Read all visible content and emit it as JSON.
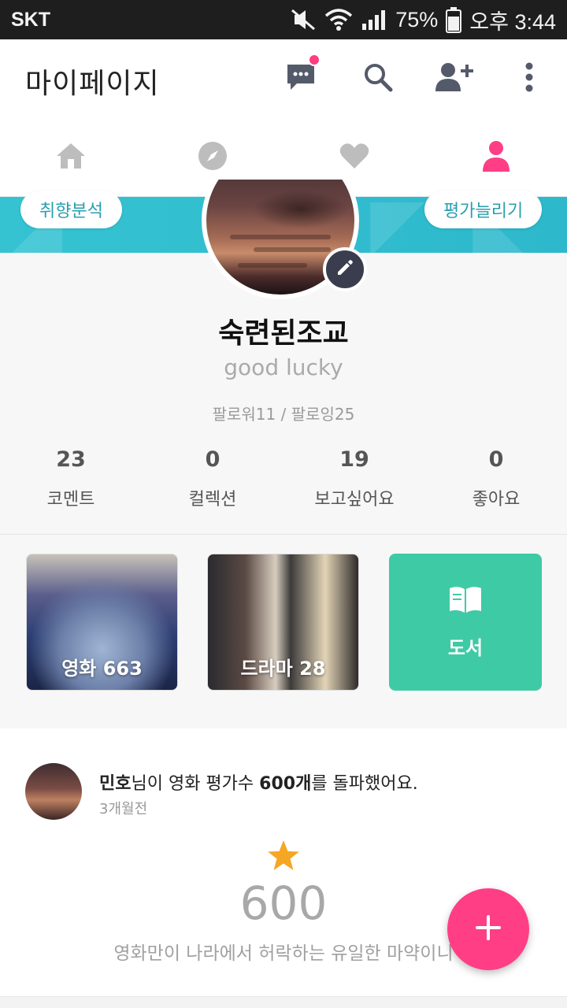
{
  "status_bar": {
    "carrier": "SKT",
    "battery": "75%",
    "time": "오후 3:44"
  },
  "app_bar": {
    "title": "마이페이지",
    "icons": [
      "chat-icon",
      "search-icon",
      "add-friend-icon",
      "more-vert-icon"
    ],
    "notification_dot_color": "#ff3e7f"
  },
  "nav_tabs": {
    "items": [
      {
        "name": "home",
        "icon": "home-icon",
        "active": false
      },
      {
        "name": "explore",
        "icon": "compass-icon",
        "active": false
      },
      {
        "name": "favorites",
        "icon": "heart-icon",
        "active": false
      },
      {
        "name": "profile",
        "icon": "person-icon",
        "active": true
      }
    ],
    "active_color": "#ff3e86",
    "inactive_color": "#bdbdbd"
  },
  "profile": {
    "analysis_button": "취향분석",
    "rate_more_button": "평가늘리기",
    "name": "숙련된조교",
    "bio": "good lucky",
    "follow_text": "팔로워11 / 팔로잉25",
    "stats": [
      {
        "value": "23",
        "label": "코멘트"
      },
      {
        "value": "0",
        "label": "컬렉션"
      },
      {
        "value": "19",
        "label": "보고싶어요"
      },
      {
        "value": "0",
        "label": "좋아요"
      }
    ]
  },
  "categories": [
    {
      "label": "영화 663",
      "type": "movie"
    },
    {
      "label": "드라마 28",
      "type": "drama"
    },
    {
      "label": "도서",
      "type": "book",
      "icon": "book-icon",
      "color": "#3fcaa6"
    }
  ],
  "feed": {
    "user": "민호",
    "message_mid": "님이 영화 평가수 ",
    "count_bold": "600개",
    "message_end": "를 돌파했어요.",
    "time": "3개월전",
    "big_number": "600",
    "quote": "영화만이 나라에서 허락하는 유일한 마약이니",
    "star_color": "#f5a623"
  },
  "fab": {
    "icon": "plus-icon",
    "color": "#ff3e86"
  },
  "banner_color": "#35c3d2"
}
